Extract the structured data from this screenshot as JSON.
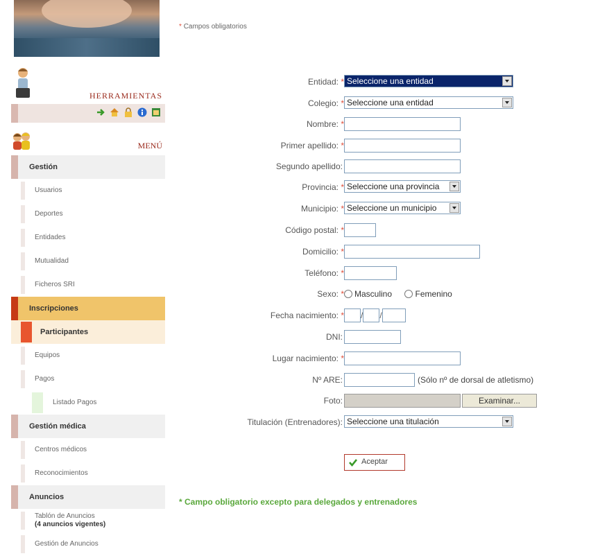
{
  "sidebar": {
    "tools_title": "HERRAMIENTAS",
    "tool_icons": [
      "exit-icon",
      "home-icon",
      "lock-icon",
      "info-icon",
      "calendar-icon"
    ],
    "menu_title": "MENÚ",
    "items": [
      {
        "type": "section",
        "label": "Gestión"
      },
      {
        "type": "sub",
        "label": "Usuarios"
      },
      {
        "type": "sub",
        "label": "Deportes"
      },
      {
        "type": "sub",
        "label": "Entidades"
      },
      {
        "type": "sub",
        "label": "Mutualidad"
      },
      {
        "type": "sub",
        "label": "Ficheros SRI"
      },
      {
        "type": "active-section",
        "label": "Inscripciones"
      },
      {
        "type": "active-sub",
        "label": "Participantes"
      },
      {
        "type": "sub",
        "label": "Equipos"
      },
      {
        "type": "sub",
        "label": "Pagos"
      },
      {
        "type": "subsub",
        "label": "Listado Pagos"
      },
      {
        "type": "section",
        "label": "Gestión médica"
      },
      {
        "type": "sub",
        "label": "Centros médicos"
      },
      {
        "type": "sub",
        "label": "Reconocimientos"
      },
      {
        "type": "section",
        "label": "Anuncios"
      },
      {
        "type": "sub2",
        "label": "Tablón de Anuncios",
        "label2": "(4 anuncios vigentes)"
      },
      {
        "type": "sub",
        "label": "Gestión de Anuncios"
      }
    ]
  },
  "form": {
    "required_note": "Campos obligatorios",
    "entidad": {
      "label": "Entidad:",
      "value": "Seleccione una entidad"
    },
    "colegio": {
      "label": "Colegio:",
      "value": "Seleccione una entidad"
    },
    "nombre": {
      "label": "Nombre:",
      "value": ""
    },
    "primer_apellido": {
      "label": "Primer apellido:",
      "value": ""
    },
    "segundo_apellido": {
      "label": "Segundo apellido:",
      "value": ""
    },
    "provincia": {
      "label": "Provincia:",
      "value": "Seleccione una provincia"
    },
    "municipio": {
      "label": "Municipio:",
      "value": "Seleccione un municipio"
    },
    "codigo_postal": {
      "label": "Código postal:",
      "value": ""
    },
    "domicilio": {
      "label": "Domicilio:",
      "value": ""
    },
    "telefono": {
      "label": "Teléfono:",
      "value": ""
    },
    "sexo": {
      "label": "Sexo:",
      "option_m": "Masculino",
      "option_f": "Femenino"
    },
    "fecha_nacimiento": {
      "label": "Fecha nacimiento:",
      "sep": "/"
    },
    "dni": {
      "label": "DNI:",
      "value": ""
    },
    "lugar_nacimiento": {
      "label": "Lugar nacimiento:",
      "value": ""
    },
    "num_are": {
      "label": "Nº ARE:",
      "value": "",
      "hint": "(Sólo nº de dorsal de atletismo)"
    },
    "foto": {
      "label": "Foto:",
      "button": "Examinar..."
    },
    "titulacion": {
      "label": "Titulación (Entrenadores):",
      "value": "Seleccione una titulación"
    },
    "submit": "Aceptar",
    "footnote": "* Campo obligatorio excepto para delegados y entrenadores"
  },
  "colors": {
    "accent_red": "#c63b16",
    "accent_orange": "#f0c46a",
    "note_green": "#5aa83c",
    "select_highlight": "#0a246a"
  }
}
